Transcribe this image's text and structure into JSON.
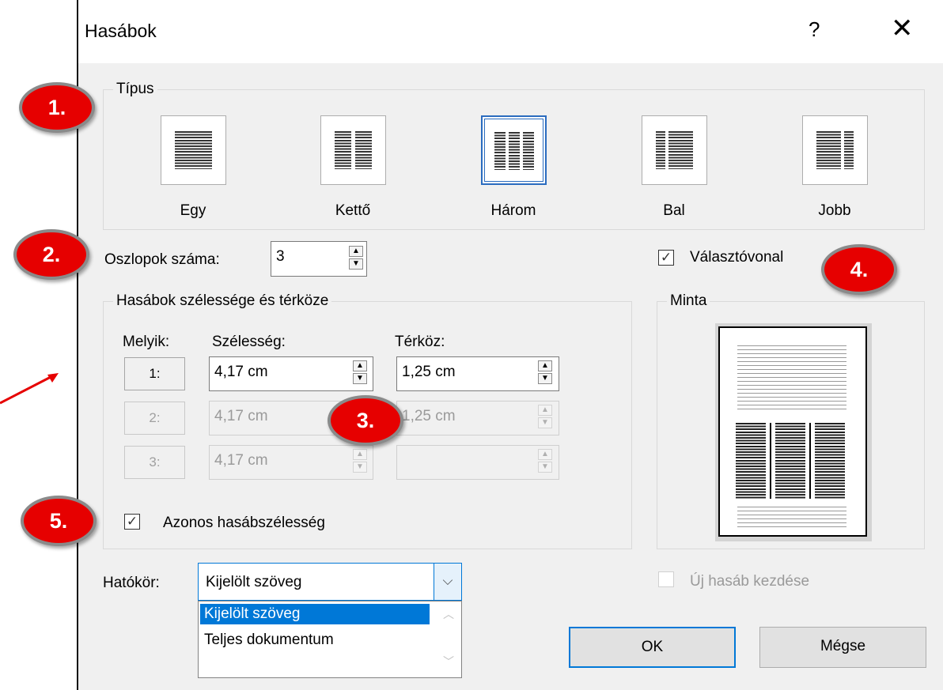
{
  "dialog": {
    "title": "Hasábok",
    "help": "?",
    "close": "✕"
  },
  "tipus": {
    "label": "Típus",
    "presets": [
      {
        "label": "Egy",
        "selected": false
      },
      {
        "label": "Kettő",
        "selected": false
      },
      {
        "label": "Három",
        "selected": true
      },
      {
        "label": "Bal",
        "selected": false
      },
      {
        "label": "Jobb",
        "selected": false
      }
    ]
  },
  "columns_count": {
    "label": "Oszlopok száma:",
    "value": "3"
  },
  "separator": {
    "label": "Választóvonal",
    "checked": true
  },
  "width_spacing": {
    "label": "Hasábok szélessége és térköze",
    "col_header": "Melyik:",
    "width_header": "Szélesség:",
    "spacing_header": "Térköz:",
    "rows": [
      {
        "num": "1:",
        "width": "4,17 cm",
        "spacing": "1,25 cm",
        "enabled": true
      },
      {
        "num": "2:",
        "width": "4,17 cm",
        "spacing": "1,25 cm",
        "enabled": false
      },
      {
        "num": "3:",
        "width": "4,17 cm",
        "spacing": "",
        "enabled": false
      }
    ],
    "equal_width": {
      "label": "Azonos hasábszélesség",
      "checked": true
    }
  },
  "preview": {
    "label": "Minta"
  },
  "scope": {
    "label": "Hatókör:",
    "value": "Kijelölt szöveg",
    "options": [
      "Kijelölt szöveg",
      "Teljes dokumentum"
    ]
  },
  "new_column": {
    "label": "Új hasáb kezdése",
    "checked": false
  },
  "buttons": {
    "ok": "OK",
    "cancel": "Mégse"
  },
  "annotations": [
    "1.",
    "2.",
    "3.",
    "4.",
    "5."
  ],
  "colors": {
    "accent": "#2b6cbf",
    "badge": "#e60000",
    "selection": "#0078d7"
  }
}
